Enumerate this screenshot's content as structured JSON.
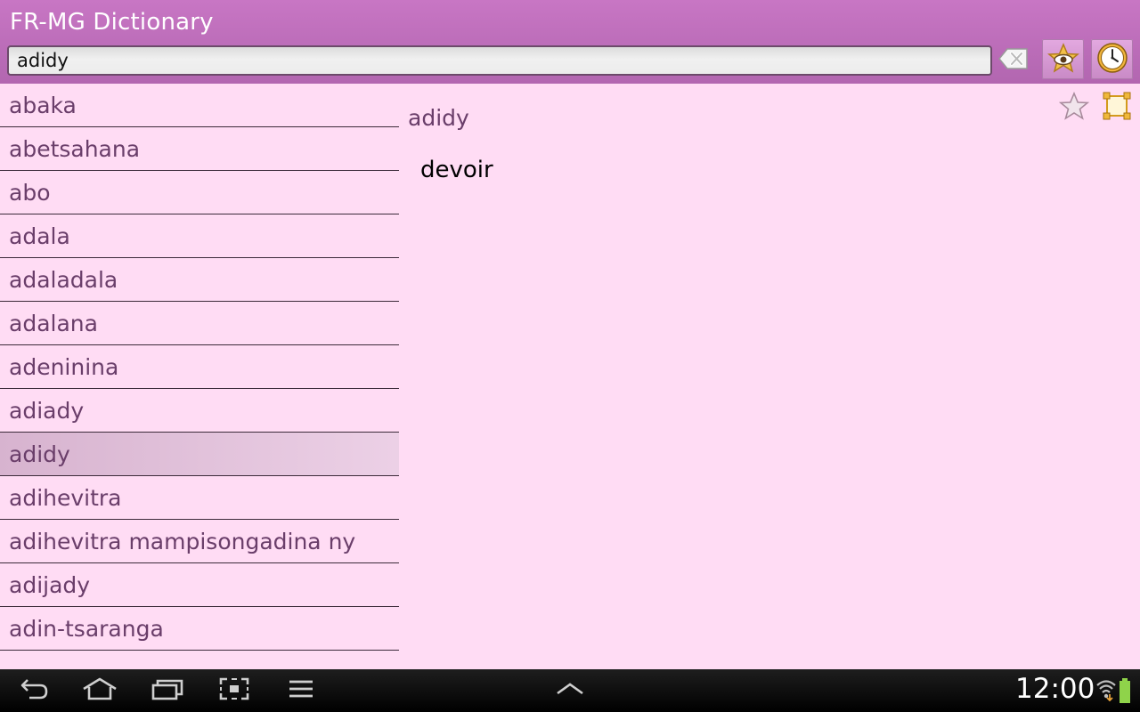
{
  "header": {
    "title": "FR-MG Dictionary",
    "search_value": "adidy",
    "icons": {
      "clear": "clear-text-icon",
      "favorites": "favorites-view-icon",
      "history": "history-clock-icon"
    }
  },
  "word_list": {
    "items": [
      {
        "label": "abaka"
      },
      {
        "label": "abetsahana"
      },
      {
        "label": "abo"
      },
      {
        "label": "adala"
      },
      {
        "label": "adaladala"
      },
      {
        "label": "adalana"
      },
      {
        "label": "adeninina"
      },
      {
        "label": "adiady"
      },
      {
        "label": "adidy"
      },
      {
        "label": "adihevitra"
      },
      {
        "label": "adihevitra mampisongadina ny"
      },
      {
        "label": "adijady"
      },
      {
        "label": "adin-tsaranga"
      }
    ],
    "selected_index": 8
  },
  "detail": {
    "word": "adidy",
    "definition": "devoir",
    "icons": {
      "favorite": "star-icon",
      "expand": "fullscreen-icon"
    }
  },
  "navbar": {
    "time": "12:00",
    "icons": [
      "back-icon",
      "home-icon",
      "recent-apps-icon",
      "screenshot-icon",
      "menu-icon",
      "up-chevron-icon",
      "wifi-icon",
      "battery-icon"
    ]
  },
  "colors": {
    "header": "#c876c4",
    "background": "#ffdcf4",
    "list_text": "#6a3e6a",
    "selected_row": "#d7b3cf"
  }
}
